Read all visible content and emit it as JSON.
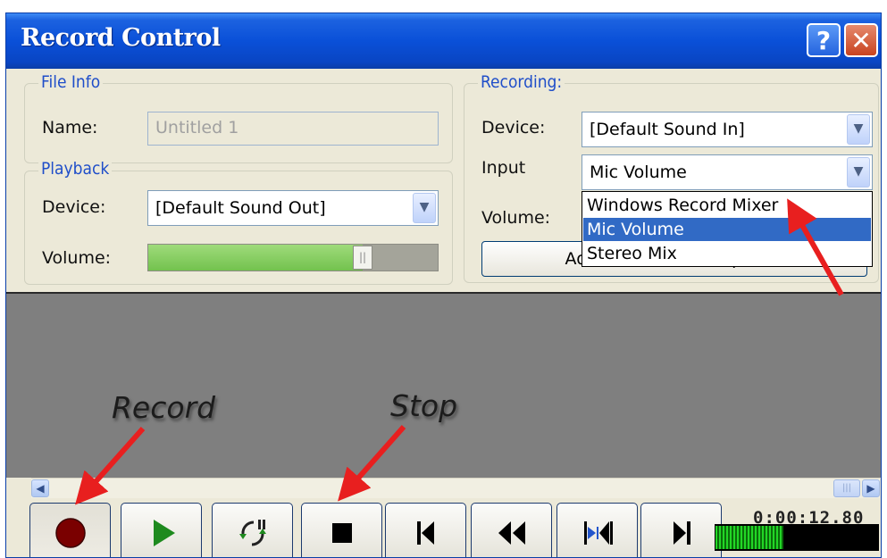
{
  "window": {
    "title": "Record Control",
    "help_label": "?",
    "close_label": "✕"
  },
  "file_info": {
    "legend": "File Info",
    "name_label": "Name:",
    "name_value": "Untitled 1"
  },
  "playback": {
    "legend": "Playback",
    "device_label": "Device:",
    "device_value": "[Default Sound Out]",
    "volume_label": "Volume:",
    "volume_level": 0.74
  },
  "recording": {
    "legend": "Recording:",
    "device_label": "Device:",
    "device_value": "[Default Sound In]",
    "input_label": "Input",
    "input_value": "Mic Volume",
    "volume_label": "Volume:",
    "advanced_label": "Advanced Record Options",
    "input_options": [
      "Windows Record Mixer",
      "Mic Volume",
      "Stereo Mix"
    ],
    "selected_option": "Mic Volume"
  },
  "annotations": {
    "record": "Record",
    "stop": "Stop"
  },
  "transport": {
    "buttons": [
      {
        "name": "record-button",
        "icon": "record-icon"
      },
      {
        "name": "play-button",
        "icon": "play-icon"
      },
      {
        "name": "loop-pause-button",
        "icon": "loop-pause-icon"
      },
      {
        "name": "stop-button",
        "icon": "stop-icon"
      },
      {
        "name": "skip-to-start-button",
        "icon": "skip-start-icon"
      },
      {
        "name": "rewind-button",
        "icon": "rewind-icon"
      },
      {
        "name": "skip-markers-button",
        "icon": "markers-icon"
      },
      {
        "name": "skip-to-end-button",
        "icon": "skip-end-icon"
      }
    ],
    "timecode": "0:00:12.80",
    "level_meter": 0.42
  },
  "colors": {
    "title_bar": "#0a50d8",
    "selection": "#316ac5",
    "record": "#7a0000",
    "play": "#1e8a1e",
    "meter": "#22d626",
    "arrow": "#e81f1f"
  }
}
